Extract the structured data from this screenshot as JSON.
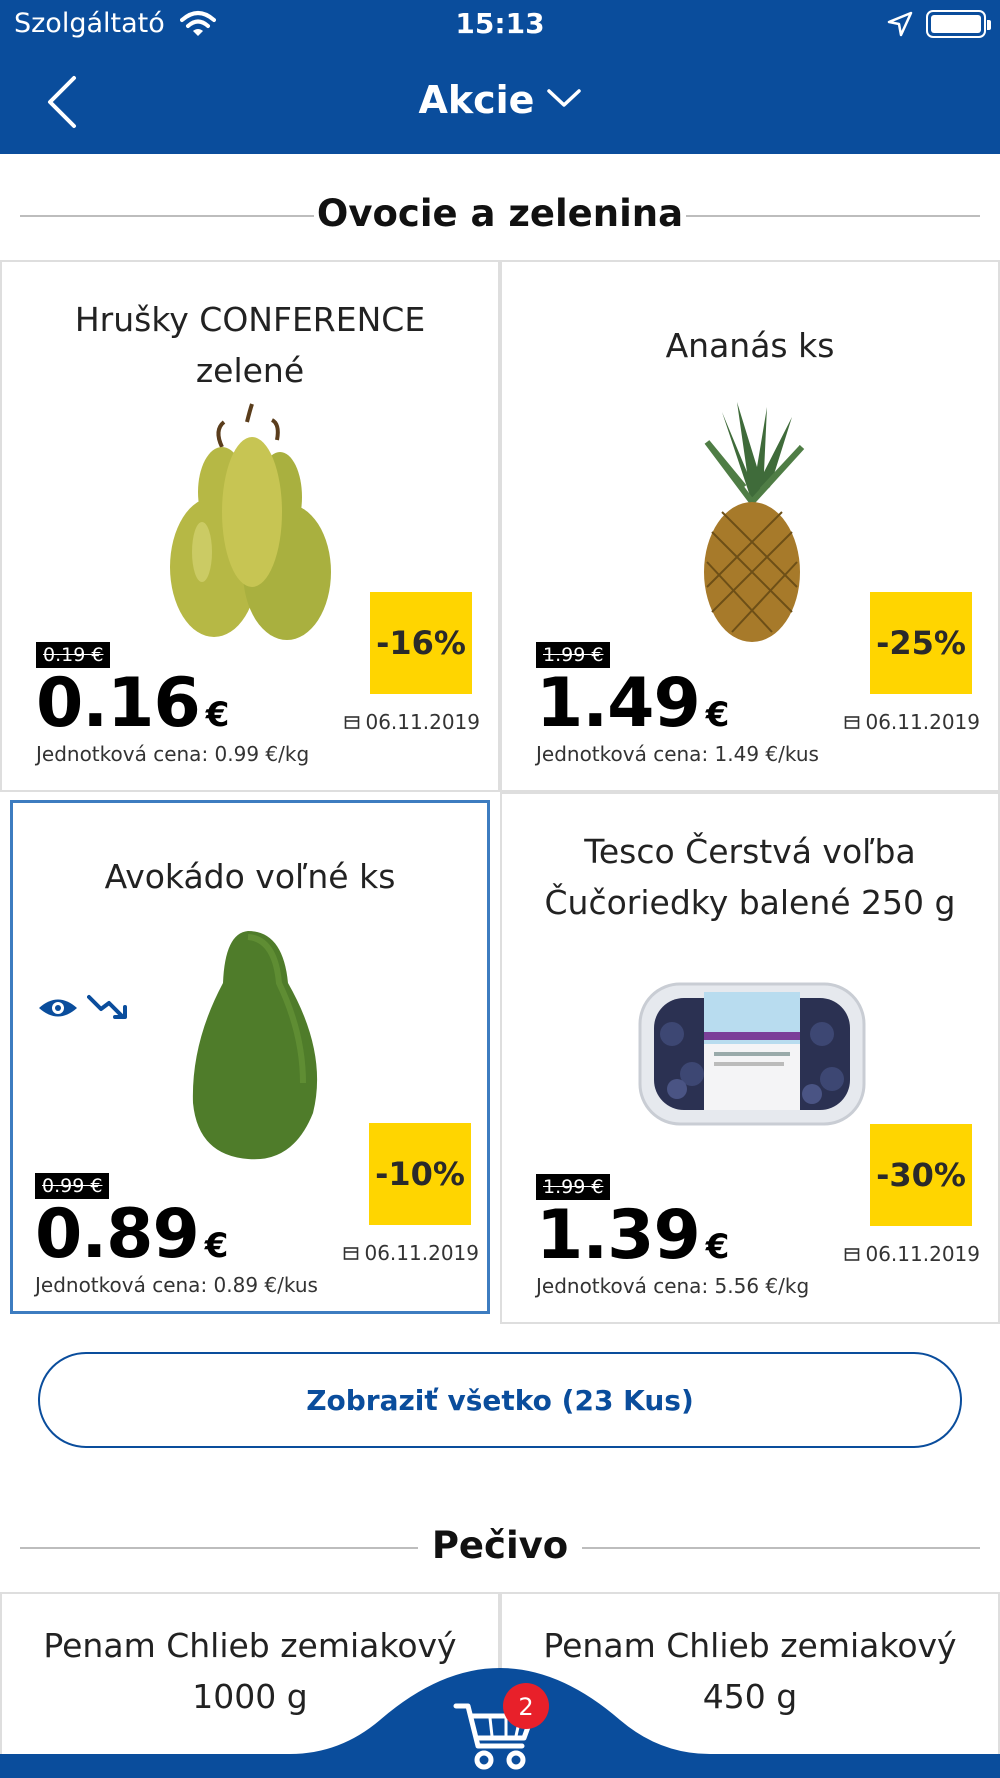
{
  "status_bar": {
    "carrier": "Szolgáltató",
    "time": "15:13"
  },
  "nav": {
    "title": "Akcie"
  },
  "sections": [
    {
      "title": "Ovocie a zelenina"
    },
    {
      "title": "Pečivo"
    }
  ],
  "products": [
    {
      "name": "Hrušky CONFERENCE zelené",
      "old_price": "0.19 €",
      "price": "0.16",
      "currency": "€",
      "discount": "-16%",
      "date": "06.11.2019",
      "unit_price": "Jednotková cena: 0.99 €/kg"
    },
    {
      "name": "Ananás ks",
      "old_price": "1.99 €",
      "price": "1.49",
      "currency": "€",
      "discount": "-25%",
      "date": "06.11.2019",
      "unit_price": "Jednotková cena: 1.49 €/kus"
    },
    {
      "name": "Avokádo voľné ks",
      "old_price": "0.99 €",
      "price": "0.89",
      "currency": "€",
      "discount": "-10%",
      "date": "06.11.2019",
      "unit_price": "Jednotková cena: 0.89 €/kus"
    },
    {
      "name": "Tesco Čerstvá voľba Čučoriedky balené 250 g",
      "old_price": "1.99 €",
      "price": "1.39",
      "currency": "€",
      "discount": "-30%",
      "date": "06.11.2019",
      "unit_price": "Jednotková cena: 5.56 €/kg"
    },
    {
      "name": "Penam Chlieb zemiakový 1000 g"
    },
    {
      "name": "Penam Chlieb zemiakový 450 g"
    }
  ],
  "show_all_label": "Zobraziť všetko (23 Kus)",
  "cart": {
    "count": "2"
  },
  "colors": {
    "brand": "#0a4d9c",
    "badge": "#ffd500",
    "selected": "#3d7cc0",
    "cart_badge": "#e8202a"
  },
  "icons": [
    "wifi-icon",
    "location-icon",
    "battery-icon",
    "back-icon",
    "chevron-down-icon",
    "calendar-icon",
    "eye-icon",
    "price-down-icon",
    "cart-icon"
  ]
}
